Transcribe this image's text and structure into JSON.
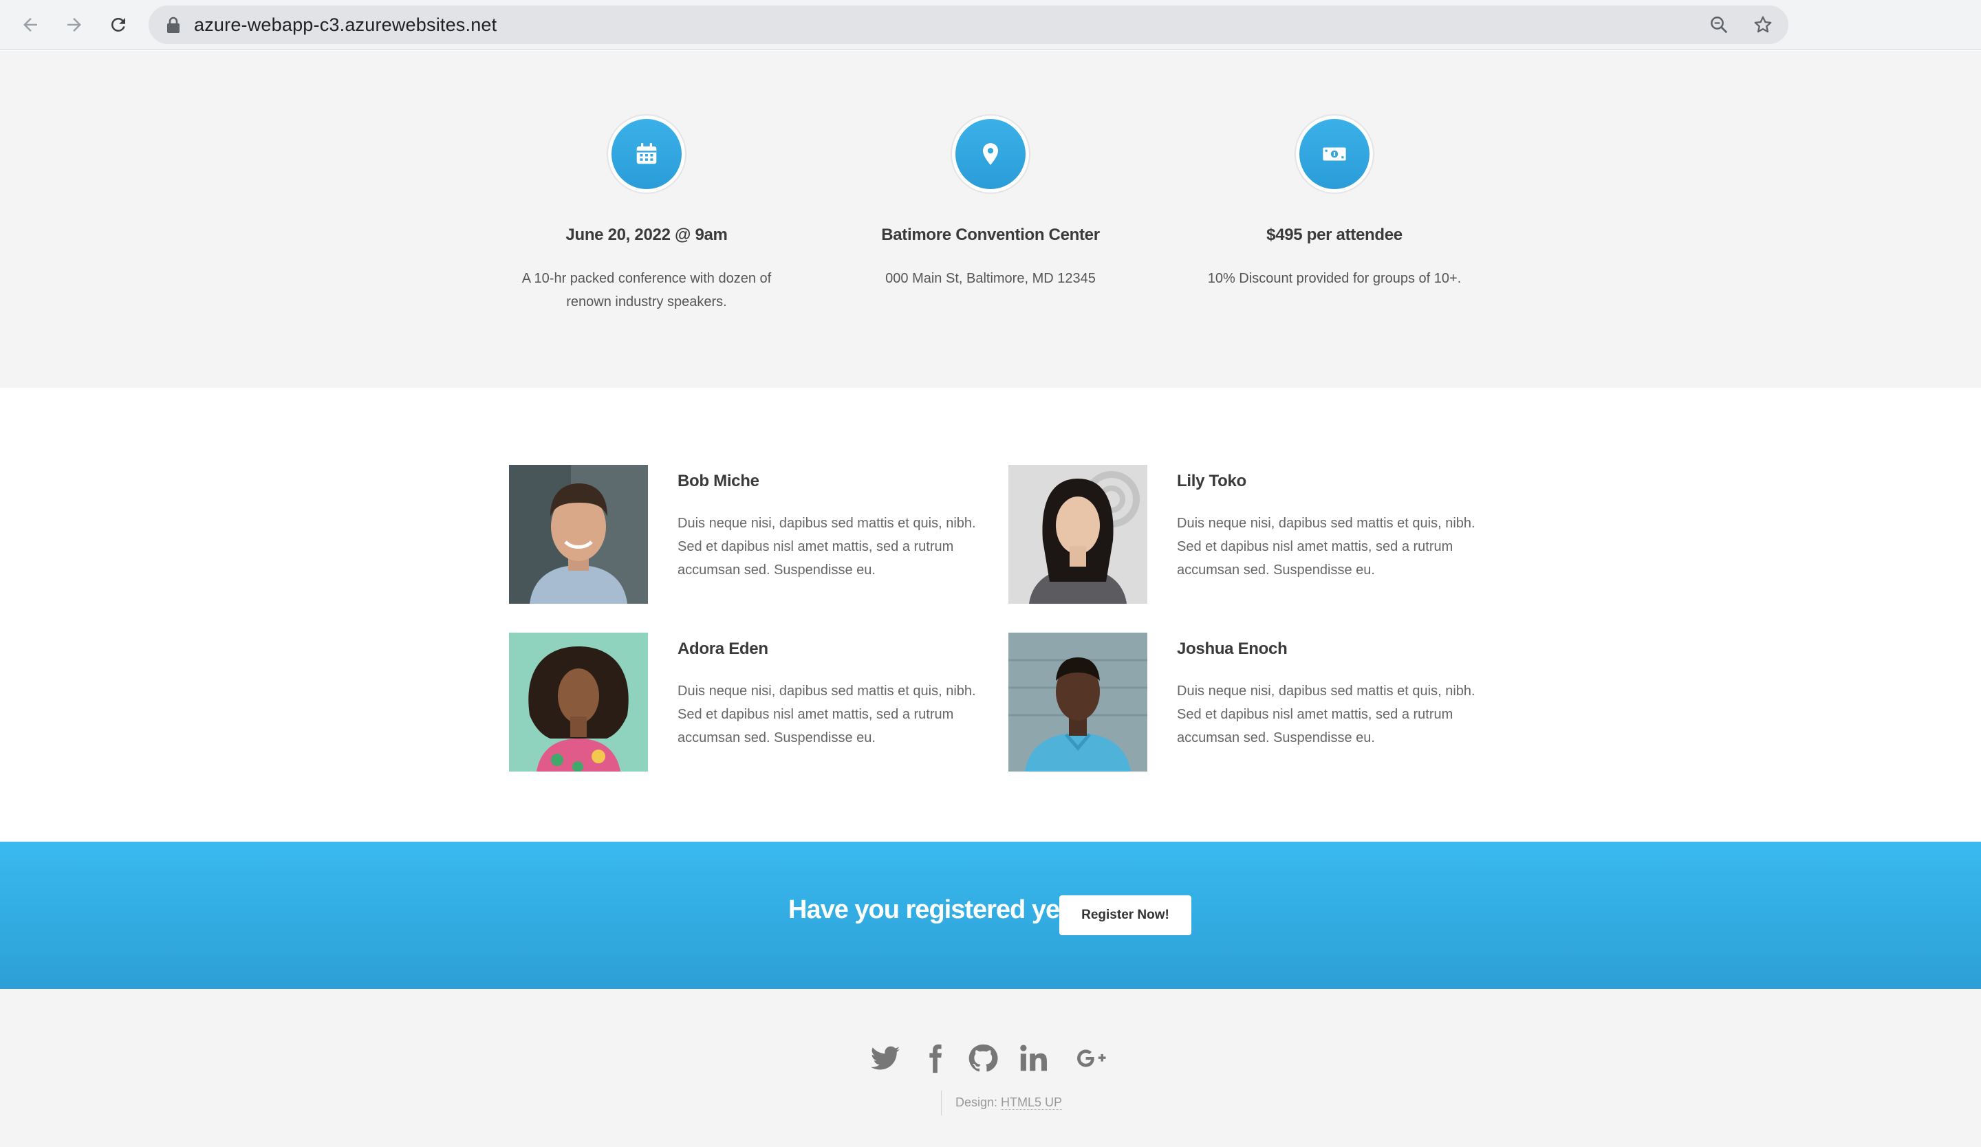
{
  "browser": {
    "url": "azure-webapp-c3.azurewebsites.net",
    "icons": [
      "back-arrow-icon",
      "forward-arrow-icon",
      "reload-icon",
      "lock-icon",
      "zoom-icon",
      "star-icon"
    ]
  },
  "features": [
    {
      "icon": "calendar-icon",
      "title": "June 20, 2022 @ 9am",
      "text": "A 10-hr packed conference with dozen of renown industry speakers."
    },
    {
      "icon": "map-marker-icon",
      "title": "Batimore Convention Center",
      "text": "000 Main St, Baltimore, MD 12345"
    },
    {
      "icon": "money-icon",
      "title": "$495 per attendee",
      "text": "10% Discount provided for groups of 10+."
    }
  ],
  "speakers": [
    {
      "name": "Bob Miche",
      "bio": "Duis neque nisi, dapibus sed mattis et quis, nibh. Sed et dapibus nisl amet mattis, sed a rutrum accumsan sed. Suspendisse eu."
    },
    {
      "name": "Lily Toko",
      "bio": "Duis neque nisi, dapibus sed mattis et quis, nibh. Sed et dapibus nisl amet mattis, sed a rutrum accumsan sed. Suspendisse eu."
    },
    {
      "name": "Adora Eden",
      "bio": "Duis neque nisi, dapibus sed mattis et quis, nibh. Sed et dapibus nisl amet mattis, sed a rutrum accumsan sed. Suspendisse eu."
    },
    {
      "name": "Joshua Enoch",
      "bio": "Duis neque nisi, dapibus sed mattis et quis, nibh. Sed et dapibus nisl amet mattis, sed a rutrum accumsan sed. Suspendisse eu."
    }
  ],
  "cta": {
    "text": "Have you registered yet?",
    "button": "Register Now!"
  },
  "footer": {
    "social_icons": [
      "twitter-icon",
      "facebook-icon",
      "github-icon",
      "linkedin-icon",
      "google-plus-icon"
    ],
    "credit_label": "Design:",
    "credit_link": "HTML5 UP"
  },
  "colors": {
    "accent": "#2fa8e0",
    "cta_top": "#39baf0",
    "cta_bottom": "#2c9fd6",
    "footer_bg": "#f4f4f4"
  }
}
